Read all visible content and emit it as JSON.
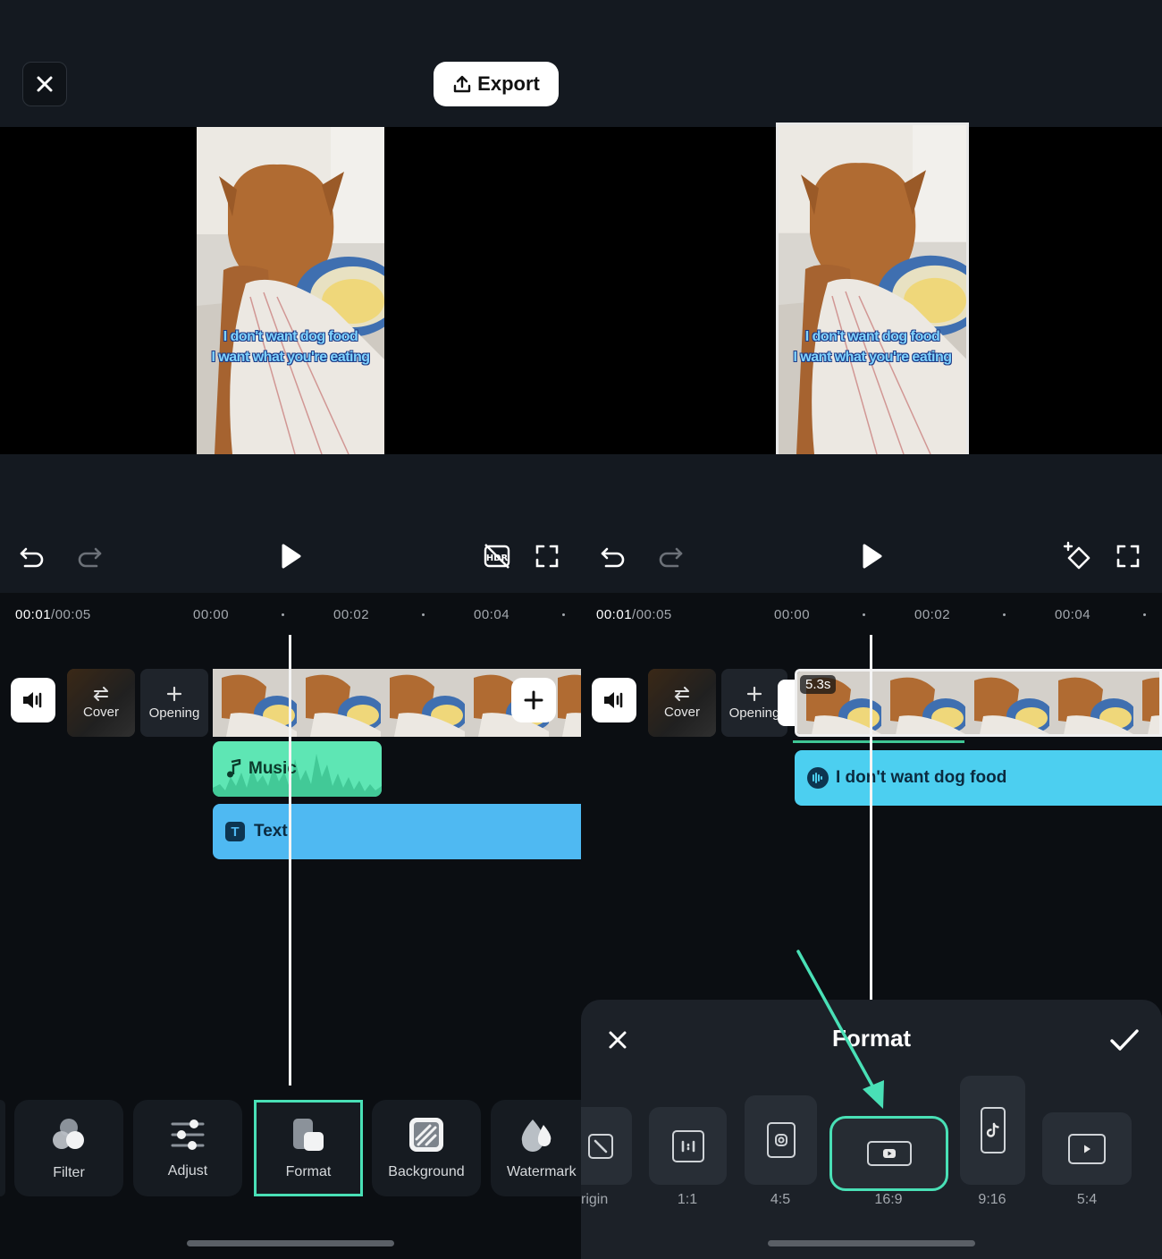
{
  "header": {
    "export_label": "Export"
  },
  "preview": {
    "caption_line1": "I don't want dog food",
    "caption_line2": "I want what you're eating"
  },
  "left": {
    "time_current": "00:01",
    "time_total": "/00:05",
    "ticks": [
      "00:00",
      "00:02",
      "00:04"
    ],
    "cover_label": "Cover",
    "opening_label": "Opening",
    "music_label": "Music",
    "text_label": "Text",
    "tools": [
      {
        "label": "Filter",
        "icon": "filter-icon"
      },
      {
        "label": "Adjust",
        "icon": "adjust-icon"
      },
      {
        "label": "Format",
        "icon": "format-icon"
      },
      {
        "label": "Background",
        "icon": "background-icon"
      },
      {
        "label": "Watermark",
        "icon": "watermark-icon"
      }
    ]
  },
  "right": {
    "time_current": "00:01",
    "time_total": "/00:05",
    "ticks": [
      "00:00",
      "00:02",
      "00:04"
    ],
    "cover_label": "Cover",
    "opening_label": "Opening",
    "clip_duration": "5.3s",
    "subtitle_label": "I don't want dog food"
  },
  "format_panel": {
    "title": "Format",
    "ratios": [
      {
        "label": "rigin",
        "icon": "origin-icon"
      },
      {
        "label": "1:1",
        "icon": "square-ratio-icon"
      },
      {
        "label": "4:5",
        "icon": "instagram-icon"
      },
      {
        "label": "16:9",
        "icon": "youtube-icon",
        "selected": true
      },
      {
        "label": "9:16",
        "icon": "tiktok-icon"
      },
      {
        "label": "5:4",
        "icon": "play-ratio-icon"
      }
    ]
  },
  "colors": {
    "accent": "#49e0b6",
    "music_track": "#5ee6b4",
    "text_track": "#4fb9f2",
    "subtitle_track": "#4ccff0",
    "caption_fill": "#7fd3ff"
  }
}
